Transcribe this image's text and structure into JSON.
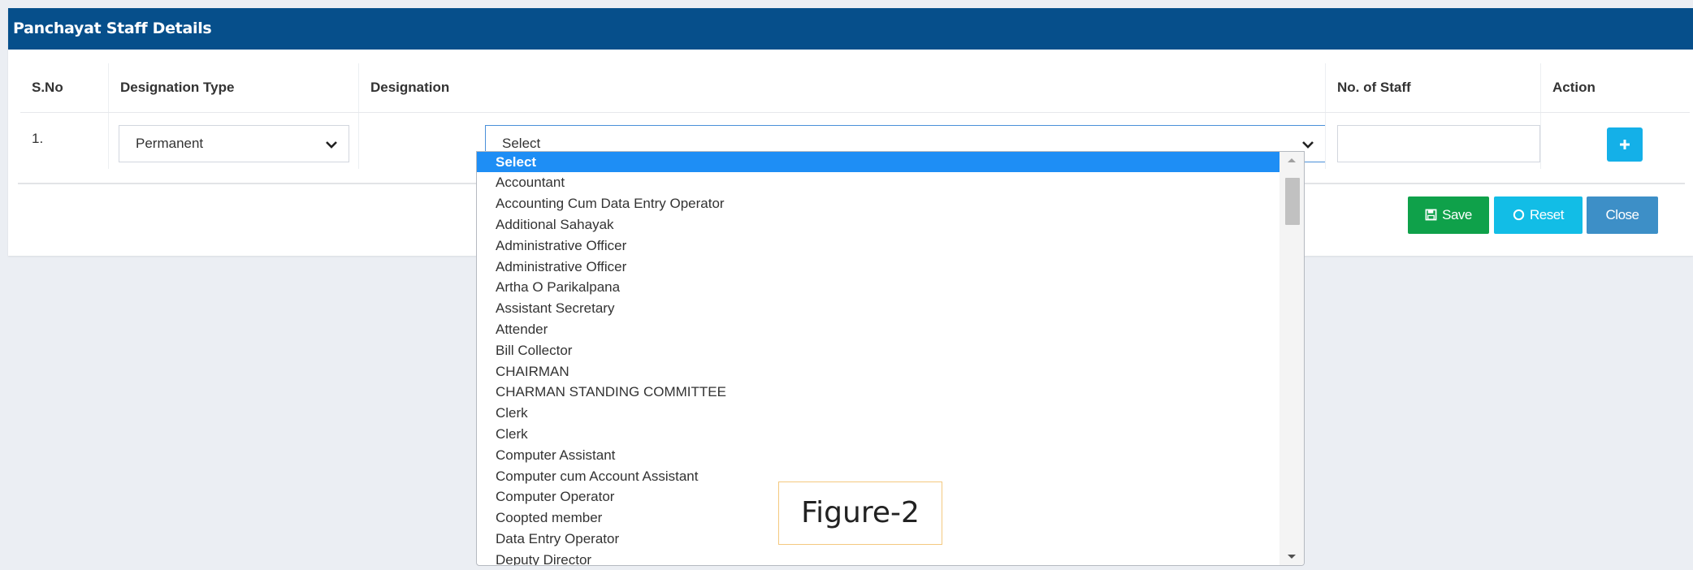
{
  "panel": {
    "title": "Panchayat Staff Details"
  },
  "table": {
    "headers": {
      "sno": "S.No",
      "designation_type": "Designation Type",
      "designation": "Designation",
      "no_of_staff": "No. of Staff",
      "action": "Action"
    },
    "row": {
      "sno": "1.",
      "designation_type": "Permanent",
      "designation": "Select",
      "no_of_staff": ""
    }
  },
  "buttons": {
    "save": "Save",
    "reset": "Reset",
    "close": "Close",
    "add_icon": "plus-icon"
  },
  "dropdown": {
    "options": [
      "Select",
      "Accountant",
      "Accounting Cum Data Entry Operator",
      "Additional Sahayak",
      "Administrative Officer",
      "Administrative Officer",
      "Artha O Parikalpana",
      "Assistant Secretary",
      "Attender",
      "Bill Collector",
      "CHAIRMAN",
      "CHARMAN STANDING COMMITTEE",
      "Clerk",
      "Clerk",
      "Computer Assistant",
      "Computer cum Account Assistant",
      "Computer Operator",
      "Coopted member",
      "Data Entry Operator",
      "Deputy Director"
    ],
    "selected": "Select"
  },
  "figure_label": "Figure-2",
  "colors": {
    "header": "#064f8b",
    "save": "#0fa14a",
    "reset": "#12bde6",
    "close": "#3d8fc7",
    "add": "#14b0e8",
    "selected": "#1e8ef5"
  }
}
